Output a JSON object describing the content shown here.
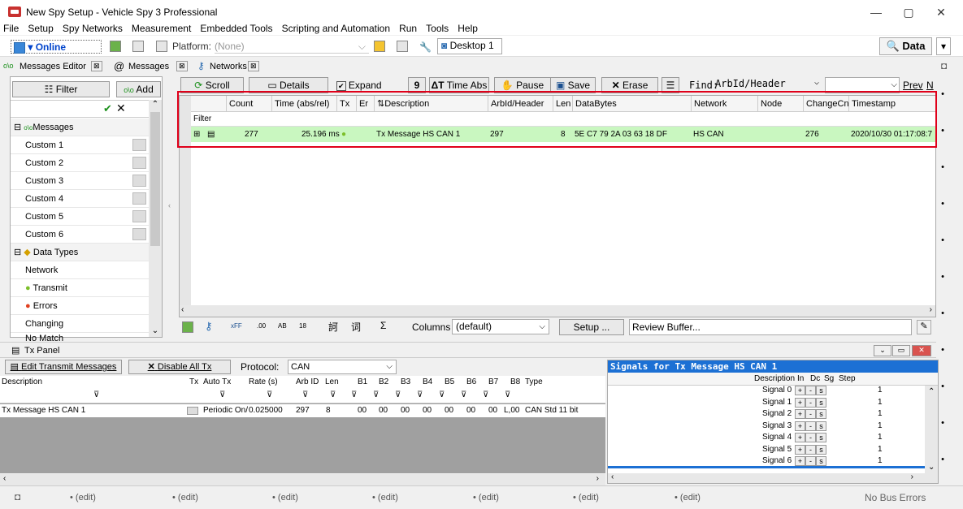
{
  "window": {
    "title": "New Spy Setup - Vehicle Spy 3 Professional",
    "minimize": "—",
    "maximize": "▢",
    "close": "✕"
  },
  "menu": [
    "File",
    "Setup",
    "Spy Networks",
    "Measurement",
    "Embedded Tools",
    "Scripting and Automation",
    "Run",
    "Tools",
    "Help"
  ],
  "toolbar": {
    "online_label": "Online",
    "platform_label": "Platform:",
    "platform_value": "(None)",
    "desktop_tab": "Desktop 1",
    "data_label": "Data"
  },
  "tabs": {
    "messages_editor": "Messages Editor",
    "messages": "Messages",
    "networks": "Networks"
  },
  "left": {
    "filter_label": "Filter",
    "add_label": "Add",
    "items": [
      "Messages",
      "Custom 1",
      "Custom 2",
      "Custom 3",
      "Custom 4",
      "Custom 5",
      "Custom 6",
      "Data Types",
      "Network",
      "Transmit",
      "Errors",
      "Changing",
      "No Match"
    ]
  },
  "msgtoolbar": {
    "scroll": "Scroll",
    "details": "Details",
    "expand": "Expand",
    "time_abs": "Time Abs",
    "pause": "Pause",
    "save": "Save",
    "erase": "Erase",
    "find_label": "Find:",
    "find_value": "ArbId/Header",
    "prev": "Prev",
    "next": "N"
  },
  "grid": {
    "headers": [
      "Count",
      "Time (abs/rel)",
      "Tx",
      "Er",
      "Description",
      "ArbId/Header",
      "Len",
      "DataBytes",
      "Network",
      "Node",
      "ChangeCnt",
      "Timestamp"
    ],
    "filter_label": "Filter",
    "row": {
      "count": "277",
      "time": "25.196 ms",
      "description": "Tx Message HS CAN 1",
      "arbid": "297",
      "len": "8",
      "databytes": "5E C7 79 2A 03 63 18 DF",
      "network": "HS CAN",
      "changecnt": "276",
      "timestamp": "2020/10/30 01:17:08:7"
    }
  },
  "bottomtb": {
    "ff": "xFF",
    ".00": ".00",
    "ab": "AB",
    "18": "18",
    "columns_label": "Columns",
    "columns_value": "(default)",
    "setup": "Setup ...",
    "review": "Review Buffer..."
  },
  "txpanel": {
    "title": "Tx Panel",
    "edit_tx": "Edit Transmit Messages",
    "disable_all": "Disable All Tx",
    "protocol_label": "Protocol:",
    "protocol_value": "CAN",
    "headers": [
      "Description",
      "Tx",
      "Auto Tx",
      "Rate (s)",
      "Arb ID",
      "Len",
      "B1",
      "B2",
      "B3",
      "B4",
      "B5",
      "B6",
      "B7",
      "B8",
      "Type"
    ],
    "row": {
      "description": "Tx Message HS CAN 1",
      "autotx": "Periodic On/",
      "rate": "0.025000",
      "arbid": "297",
      "len": "8",
      "b": [
        "00",
        "00",
        "00",
        "00",
        "00",
        "00",
        "00"
      ],
      "b8": "L,00",
      "type": "CAN Std 11 bit"
    }
  },
  "signals": {
    "title": "Signals for Tx Message HS CAN 1",
    "headers": [
      "Description",
      "In",
      "Dc",
      "Sg",
      "Step"
    ],
    "rows": [
      {
        "name": "Signal 0",
        "step": "1"
      },
      {
        "name": "Signal 1",
        "step": "1"
      },
      {
        "name": "Signal 2",
        "step": "1"
      },
      {
        "name": "Signal 3",
        "step": "1"
      },
      {
        "name": "Signal 4",
        "step": "1"
      },
      {
        "name": "Signal 5",
        "step": "1"
      },
      {
        "name": "Signal 6",
        "step": "1"
      }
    ]
  },
  "status": {
    "edit": "• (edit)",
    "bus": "No Bus Errors"
  }
}
